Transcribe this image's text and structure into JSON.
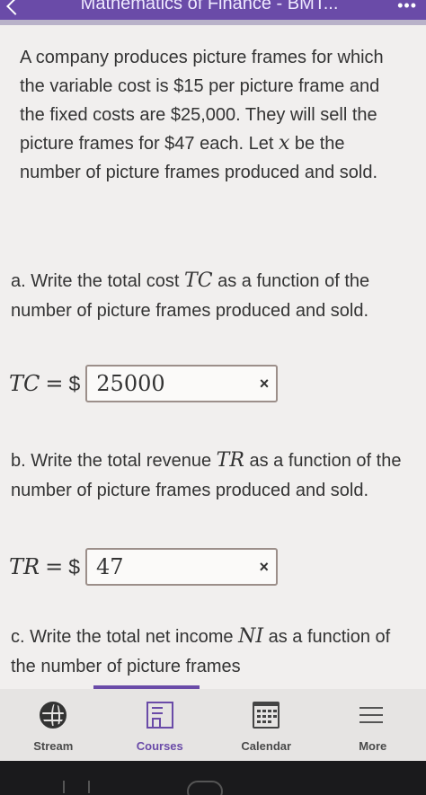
{
  "header": {
    "title": "Mathematics of Finance - BMT...",
    "menu_dots": "•••"
  },
  "problem": {
    "text_1": "A company produces picture frames for which the variable cost is $15 per picture frame and the fixed costs are $25,000. They will sell the picture frames for $47 each. Let ",
    "var_x": "x",
    "text_2": " be the number of picture frames produced and sold."
  },
  "part_a": {
    "prompt_1": "a. Write the total cost ",
    "math": "TC",
    "prompt_2": " as a function of the number of picture frames produced and sold.",
    "label": "TC",
    "equals": "=",
    "currency": "$",
    "value": "25000",
    "clear": "×"
  },
  "part_b": {
    "prompt_1": "b. Write the total revenue ",
    "math": "TR",
    "prompt_2": " as a function of the number of picture frames produced and sold.",
    "label": "TR",
    "equals": "=",
    "currency": "$",
    "value": "47",
    "clear": "×"
  },
  "part_c": {
    "prompt_1": "c. Write the total net income ",
    "math": "NI",
    "prompt_2": " as a function of the number of picture frames"
  },
  "nav": {
    "items": [
      {
        "label": "Stream"
      },
      {
        "label": "Courses"
      },
      {
        "label": "Calendar"
      },
      {
        "label": "More"
      }
    ]
  },
  "colors": {
    "accent": "#6a4ba8"
  }
}
